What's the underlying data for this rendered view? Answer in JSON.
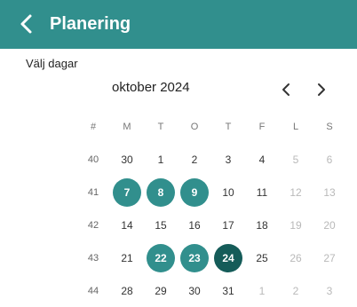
{
  "header": {
    "title": "Planering"
  },
  "subtitle": "Välj dagar",
  "calendar": {
    "month_label": "oktober 2024",
    "weekday_headers": [
      "#",
      "M",
      "T",
      "O",
      "T",
      "F",
      "L",
      "S"
    ],
    "weeks": [
      {
        "week": "40",
        "days": [
          {
            "d": "30",
            "state": "normal"
          },
          {
            "d": "1",
            "state": "normal"
          },
          {
            "d": "2",
            "state": "normal"
          },
          {
            "d": "3",
            "state": "normal"
          },
          {
            "d": "4",
            "state": "normal"
          },
          {
            "d": "5",
            "state": "muted"
          },
          {
            "d": "6",
            "state": "muted"
          }
        ]
      },
      {
        "week": "41",
        "days": [
          {
            "d": "7",
            "state": "selected"
          },
          {
            "d": "8",
            "state": "selected"
          },
          {
            "d": "9",
            "state": "selected"
          },
          {
            "d": "10",
            "state": "normal"
          },
          {
            "d": "11",
            "state": "normal"
          },
          {
            "d": "12",
            "state": "muted"
          },
          {
            "d": "13",
            "state": "muted"
          }
        ]
      },
      {
        "week": "42",
        "days": [
          {
            "d": "14",
            "state": "normal"
          },
          {
            "d": "15",
            "state": "normal"
          },
          {
            "d": "16",
            "state": "normal"
          },
          {
            "d": "17",
            "state": "normal"
          },
          {
            "d": "18",
            "state": "normal"
          },
          {
            "d": "19",
            "state": "muted"
          },
          {
            "d": "20",
            "state": "muted"
          }
        ]
      },
      {
        "week": "43",
        "days": [
          {
            "d": "21",
            "state": "normal"
          },
          {
            "d": "22",
            "state": "selected"
          },
          {
            "d": "23",
            "state": "selected"
          },
          {
            "d": "24",
            "state": "today"
          },
          {
            "d": "25",
            "state": "normal"
          },
          {
            "d": "26",
            "state": "muted"
          },
          {
            "d": "27",
            "state": "muted"
          }
        ]
      },
      {
        "week": "44",
        "days": [
          {
            "d": "28",
            "state": "normal"
          },
          {
            "d": "29",
            "state": "normal"
          },
          {
            "d": "30",
            "state": "normal"
          },
          {
            "d": "31",
            "state": "normal"
          },
          {
            "d": "1",
            "state": "muted"
          },
          {
            "d": "2",
            "state": "muted"
          },
          {
            "d": "3",
            "state": "muted"
          }
        ]
      }
    ]
  },
  "colors": {
    "header": "#318f8d",
    "selected": "#318f8d",
    "today": "#155c59"
  }
}
